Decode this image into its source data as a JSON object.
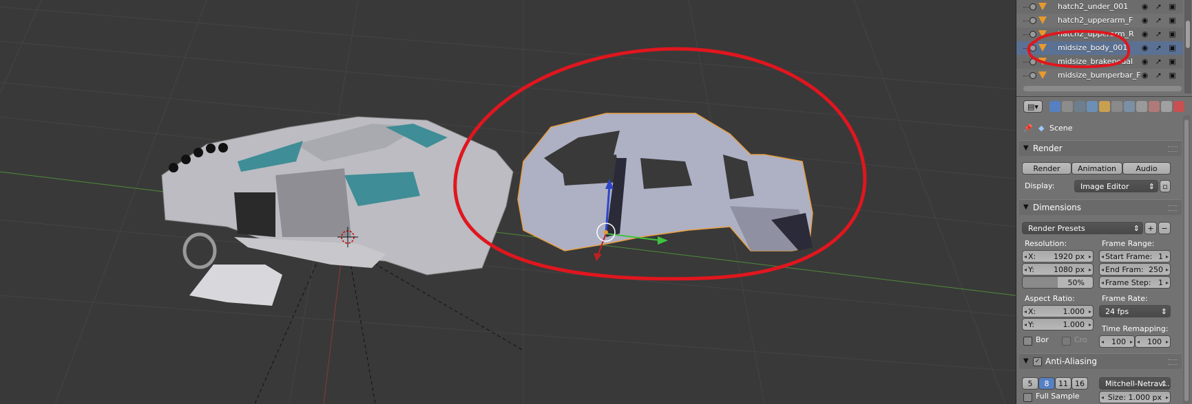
{
  "outliner": {
    "rows": [
      {
        "name": "hatch2_under_001",
        "selected": false
      },
      {
        "name": "hatch2_upperarm_F",
        "selected": false
      },
      {
        "name": "hatch2_upperarm_R",
        "selected": false
      },
      {
        "name": "midsize_body_001",
        "selected": true
      },
      {
        "name": "midsize_brakepedal",
        "selected": false
      },
      {
        "name": "midsize_bumperbar_F",
        "selected": false
      }
    ]
  },
  "properties": {
    "context_label": "Scene",
    "render_panel": {
      "title": "Render",
      "render_btn": "Render",
      "animation_btn": "Animation",
      "audio_btn": "Audio",
      "display_label": "Display:",
      "display_value": "Image Editor"
    },
    "dimensions_panel": {
      "title": "Dimensions",
      "presets": "Render Presets",
      "resolution_label": "Resolution:",
      "res_x_label": "X:",
      "res_x": "1920 px",
      "res_y_label": "Y:",
      "res_y": "1080 px",
      "res_pct": "50%",
      "frame_range_label": "Frame Range:",
      "start_label": "Start Frame:",
      "start": "1",
      "end_label": "End Fram:",
      "end": "250",
      "step_label": "Frame Step:",
      "step": "1",
      "aspect_label": "Aspect Ratio:",
      "asp_x_label": "X:",
      "asp_x": "1.000",
      "asp_y_label": "Y:",
      "asp_y": "1.000",
      "frame_rate_label": "Frame Rate:",
      "frame_rate": "24 fps",
      "border_label": "Bor",
      "crop_label": "Cro",
      "time_remap_label": "Time Remapping:",
      "remap_old": "100",
      "remap_new": "100"
    },
    "aa_panel": {
      "title": "Anti-Aliasing",
      "samples": [
        "5",
        "8",
        "11",
        "16"
      ],
      "selected_sample": "8",
      "filter": "Mitchell-Netrav...",
      "full_sample_label": "Full Sample",
      "size": "Size: 1.000 px"
    }
  },
  "colors": {
    "viewport_bg": "#393939",
    "annotation_red": "#e0161e",
    "selection_blue": "#5b7193",
    "active_button": "#5680c2",
    "object_outline": "#e8a040"
  },
  "icons": {
    "pin": "pin-icon",
    "scene": "scene-icon",
    "eye": "eye-icon",
    "cursor": "cursor-icon",
    "render_camera": "camera-icon"
  }
}
